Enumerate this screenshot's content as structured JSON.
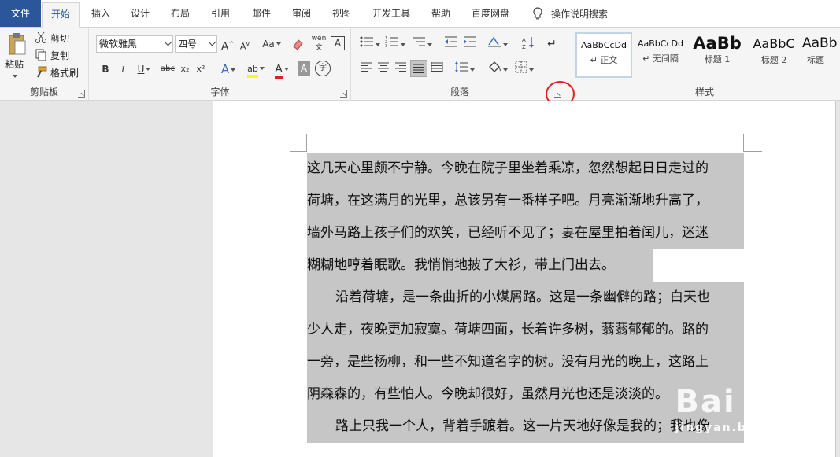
{
  "tabs": {
    "file": "文件",
    "home": "开始",
    "insert": "插入",
    "design": "设计",
    "layout": "布局",
    "references": "引用",
    "mailings": "邮件",
    "review": "审阅",
    "view": "视图",
    "developer": "开发工具",
    "help": "帮助",
    "baidu": "百度网盘",
    "tell_me": "操作说明搜索"
  },
  "clipboard": {
    "paste": "粘贴",
    "cut": "剪切",
    "copy": "复制",
    "format_painter": "格式刷",
    "label": "剪贴板"
  },
  "font": {
    "name": "微软雅黑",
    "size": "四号",
    "grow": "A",
    "shrink": "A",
    "case": "Aa",
    "phonetic": "wén",
    "border": "A",
    "bold": "B",
    "italic": "I",
    "underline": "U",
    "strike": "abc",
    "subscript": "x₂",
    "superscript": "x²",
    "effects": "A",
    "highlight": "ab",
    "color": "A",
    "shade": "A",
    "enclose": "字",
    "label": "字体"
  },
  "paragraph": {
    "label": "段落"
  },
  "styles": {
    "label": "样式",
    "items": [
      {
        "sample": "AaBbCcDd",
        "name": "↵ 正文"
      },
      {
        "sample": "AaBbCcDd",
        "name": "↵ 无间隔"
      },
      {
        "sample": "AaBb",
        "name": "标题 1"
      },
      {
        "sample": "AaBbC",
        "name": "标题 2"
      },
      {
        "sample": "AaBb",
        "name": "标题"
      }
    ]
  },
  "document": {
    "lines": [
      "这几天心里颇不宁静。今晚在院子里坐着乘凉，忽然想起日日走过的",
      "荷塘，在这满月的光里，总该另有一番样子吧。月亮渐渐地升高了，",
      "墙外马路上孩子们的欢笑，已经听不见了；妻在屋里拍着闰儿，迷迷",
      "糊糊地哼着眠歌。我悄悄地披了大衫，带上门出去。",
      "沿着荷塘，是一条曲折的小煤屑路。这是一条幽僻的路；白天也",
      "少人走，夜晚更加寂寞。荷塘四面，长着许多树，蓊蓊郁郁的。路的",
      "一旁，是些杨柳，和一些不知道名字的树。没有月光的晚上，这路上",
      "阴森森的，有些怕人。今晚却很好，虽然月光也还是淡淡的。",
      "路上只我一个人，背着手踱着。这一片天地好像是我的；我也像"
    ]
  },
  "watermark": {
    "text": "Bai 经验",
    "sub": "jingyan.baidu.com"
  },
  "colors": {
    "file_tab": "#2b579a",
    "selection": "#c6c6c6",
    "highlight_marker": "#e02020"
  }
}
